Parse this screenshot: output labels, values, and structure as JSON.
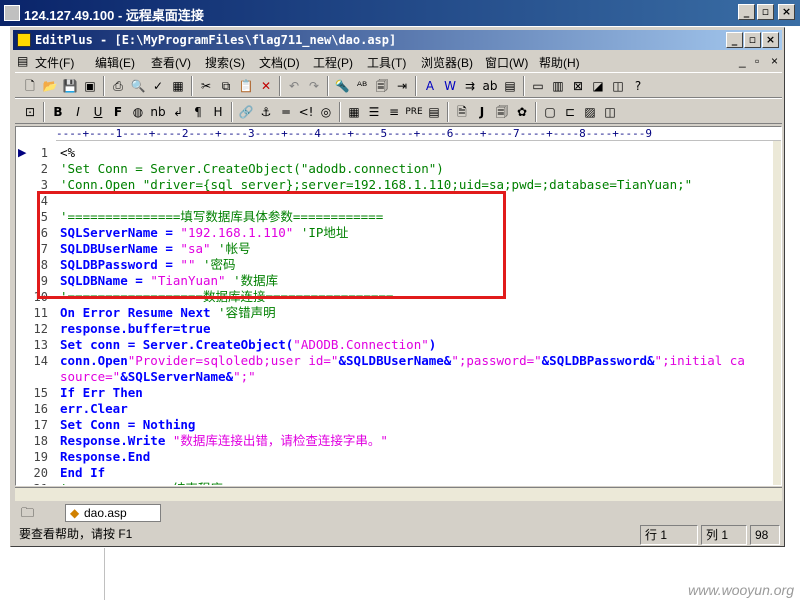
{
  "rdp": {
    "title": "124.127.49.100 - 远程桌面连接"
  },
  "editplus": {
    "title": "EditPlus - [E:\\MyProgramFiles\\flag711_new\\dao.asp]"
  },
  "menu": [
    "文件(F)",
    "编辑(E)",
    "查看(V)",
    "搜索(S)",
    "文档(D)",
    "工程(P)",
    "工具(T)",
    "浏览器(B)",
    "窗口(W)",
    "帮助(H)"
  ],
  "ruler": "----+----1----+----2----+----3----+----4----+----5----+----6----+----7----+----8----+----9",
  "code_lines": [
    {
      "num": "1",
      "segs": [
        {
          "t": "<%",
          "c": "plain"
        }
      ]
    },
    {
      "num": "2",
      "segs": [
        {
          "t": "'Set Conn = Server.CreateObject(\"adodb.connection\")",
          "c": "cmt"
        }
      ]
    },
    {
      "num": "3",
      "segs": [
        {
          "t": "'Conn.Open \"driver={sql server};server=192.168.1.110;uid=sa;pwd=;database=TianYuan;\"",
          "c": "cmt"
        }
      ]
    },
    {
      "num": "4",
      "segs": []
    },
    {
      "num": "5",
      "segs": [
        {
          "t": "'===============填写数据库具体参数============",
          "c": "cmt"
        }
      ]
    },
    {
      "num": "6",
      "segs": [
        {
          "t": "SQLServerName",
          "c": "kw"
        },
        {
          "t": " = ",
          "c": "kw"
        },
        {
          "t": "\"192.168.1.110\"",
          "c": "str"
        },
        {
          "t": " 'IP地址",
          "c": "cmt"
        }
      ]
    },
    {
      "num": "7",
      "segs": [
        {
          "t": "SQLDBUserName",
          "c": "kw"
        },
        {
          "t": " = ",
          "c": "kw"
        },
        {
          "t": "\"sa\"",
          "c": "str"
        },
        {
          "t": " '帐号",
          "c": "cmt"
        }
      ]
    },
    {
      "num": "8",
      "segs": [
        {
          "t": "SQLDBPassword",
          "c": "kw"
        },
        {
          "t": " = ",
          "c": "kw"
        },
        {
          "t": "\"\"",
          "c": "str"
        },
        {
          "t": " '密码",
          "c": "cmt"
        }
      ]
    },
    {
      "num": "9",
      "segs": [
        {
          "t": "SQLDBName",
          "c": "kw"
        },
        {
          "t": " = ",
          "c": "kw"
        },
        {
          "t": "\"TianYuan\"",
          "c": "str"
        },
        {
          "t": " '数据库",
          "c": "cmt"
        }
      ]
    },
    {
      "num": "10",
      "segs": [
        {
          "t": "'==================数据库连接=================",
          "c": "cmt"
        }
      ]
    },
    {
      "num": "11",
      "segs": [
        {
          "t": "On Error Resume Next",
          "c": "kw"
        },
        {
          "t": " '容错声明",
          "c": "cmt"
        }
      ]
    },
    {
      "num": "12",
      "segs": [
        {
          "t": "response.buffer=true",
          "c": "kw"
        }
      ]
    },
    {
      "num": "13",
      "segs": [
        {
          "t": "Set conn = Server.CreateObject(",
          "c": "kw"
        },
        {
          "t": "\"ADODB.Connection\"",
          "c": "str"
        },
        {
          "t": ")",
          "c": "kw"
        }
      ]
    },
    {
      "num": "14",
      "segs": [
        {
          "t": "conn.Open",
          "c": "kw"
        },
        {
          "t": "\"Provider=sqloledb;user id=\"",
          "c": "str"
        },
        {
          "t": "&SQLDBUserName&",
          "c": "kw"
        },
        {
          "t": "\";password=\"",
          "c": "str"
        },
        {
          "t": "&SQLDBPassword&",
          "c": "kw"
        },
        {
          "t": "\";initial ca",
          "c": "str"
        }
      ]
    },
    {
      "num": "",
      "segs": [
        {
          "t": "source=\"",
          "c": "str"
        },
        {
          "t": "&SQLServerName&",
          "c": "kw"
        },
        {
          "t": "\";\"",
          "c": "str"
        }
      ]
    },
    {
      "num": "15",
      "segs": [
        {
          "t": "If Err Then",
          "c": "kw"
        }
      ]
    },
    {
      "num": "16",
      "segs": [
        {
          "t": "err.Clear",
          "c": "kw"
        }
      ]
    },
    {
      "num": "17",
      "segs": [
        {
          "t": "Set Conn = Nothing",
          "c": "kw"
        }
      ]
    },
    {
      "num": "18",
      "segs": [
        {
          "t": "Response.Write ",
          "c": "kw"
        },
        {
          "t": "\"数据库连接出错，请检查连接字串。\"",
          "c": "str"
        }
      ]
    },
    {
      "num": "19",
      "segs": [
        {
          "t": "Response.End",
          "c": "kw"
        }
      ]
    },
    {
      "num": "20",
      "segs": [
        {
          "t": "End If",
          "c": "kw"
        }
      ]
    },
    {
      "num": "21",
      "segs": [
        {
          "t": "'==============结束程序======================",
          "c": "cmt"
        }
      ]
    }
  ],
  "tab": {
    "label": "dao.asp"
  },
  "status": {
    "help": "要查看帮助，请按 F1",
    "row": "行 1",
    "col": "列 1",
    "count": "98"
  },
  "watermark": "www.wooyun.org"
}
